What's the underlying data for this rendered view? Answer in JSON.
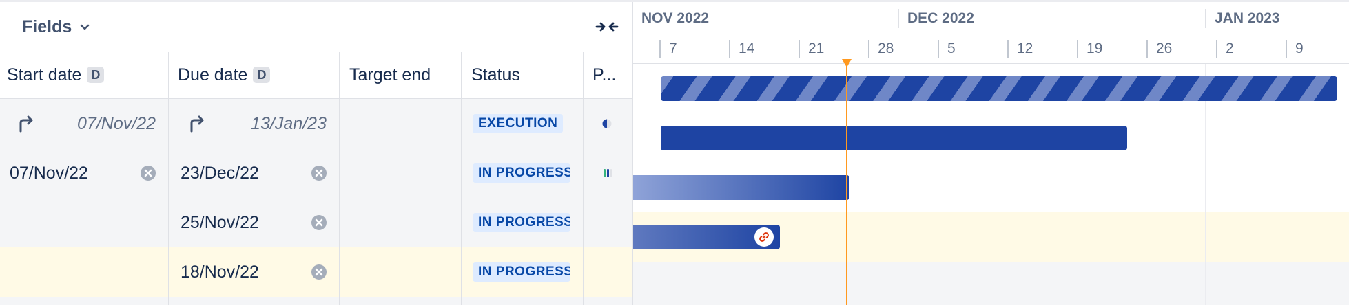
{
  "toolbar": {
    "fields_label": "Fields"
  },
  "columns": [
    {
      "label": "Start date",
      "badge": "D"
    },
    {
      "label": "Due date",
      "badge": "D"
    },
    {
      "label": "Target end"
    },
    {
      "label": "Status"
    },
    {
      "label": "P..."
    }
  ],
  "rows": [
    {
      "start": "07/Nov/22",
      "start_inferred": true,
      "due": "13/Jan/23",
      "due_inferred": true,
      "status": "EXECUTION",
      "highlighted": false
    },
    {
      "start": "07/Nov/22",
      "start_inferred": false,
      "due": "23/Dec/22",
      "due_inferred": false,
      "status": "IN PROGRESS",
      "highlighted": false
    },
    {
      "start": "",
      "start_inferred": false,
      "due": "25/Nov/22",
      "due_inferred": false,
      "status": "IN PROGRESS",
      "highlighted": false
    },
    {
      "start": "",
      "start_inferred": false,
      "due": "18/Nov/22",
      "due_inferred": false,
      "status": "IN PROGRESS",
      "highlighted": true
    }
  ],
  "timeline": {
    "months": [
      "NOV 2022",
      "DEC 2022",
      "JAN 2023"
    ],
    "weeks": [
      "7",
      "14",
      "21",
      "28",
      "5",
      "12",
      "19",
      "26",
      "2",
      "9"
    ],
    "today": "Today"
  },
  "colors": {
    "bar_primary": "#1e44a3",
    "today": "#ff991f",
    "status_bg": "#deebff",
    "status_text": "#0747a6"
  }
}
